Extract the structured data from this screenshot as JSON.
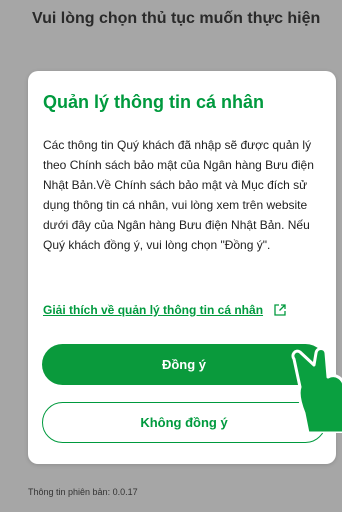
{
  "background": {
    "title": "Vui lòng chọn thủ tục muốn thực hiện",
    "version": "Thông tin phiên bản: 0.0.17"
  },
  "dialog": {
    "title": "Quản lý thông tin cá nhân",
    "body": "Các thông tin Quý khách đã nhập sẽ được quản lý theo Chính sách bảo mật của Ngân hàng Bưu điện Nhật Bản.Về Chính sách bảo mật và Mục đích sử dụng thông tin cá nhân, vui lòng xem trên website dưới đây của Ngân hàng Bưu điện Nhật Bản. Nếu Quý khách đồng ý, vui lòng chọn \"Đồng ý\".",
    "link_label": "Giải thích về quản lý thông tin cá nhân",
    "agree_label": "Đồng ý",
    "disagree_label": "Không đồng ý"
  },
  "colors": {
    "accent": "#009a3e",
    "overlay": "#a6a6a6"
  },
  "icons": {
    "external_link": "external-link-icon",
    "pointer": "pointing-hand-icon"
  }
}
